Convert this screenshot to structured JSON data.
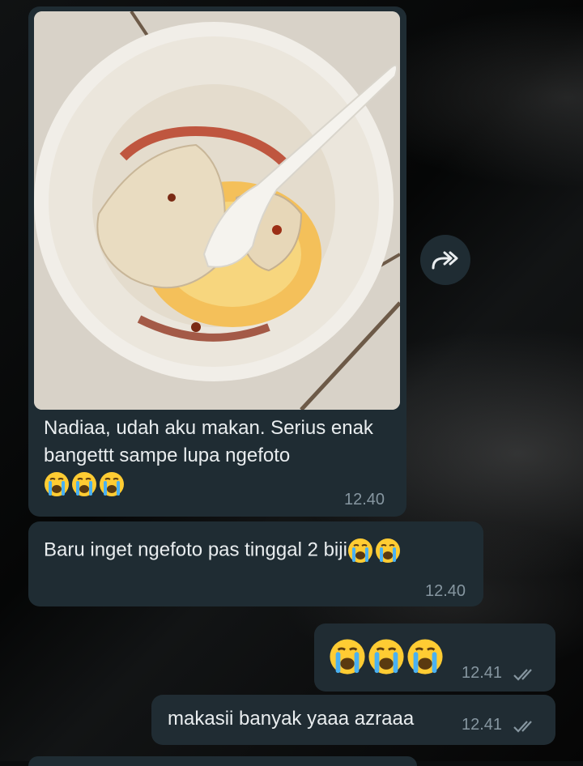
{
  "messages": [
    {
      "direction": "incoming",
      "type": "image",
      "caption": "Nadiaa, udah aku makan. Serius enak bangettt sampe lupa ngefoto",
      "emojis": [
        "loudly-crying-face",
        "loudly-crying-face",
        "loudly-crying-face"
      ],
      "time": "12.40"
    },
    {
      "direction": "incoming",
      "type": "text",
      "text": "Baru inget ngefoto pas tinggal 2 biji",
      "emojis": [
        "loudly-crying-face",
        "loudly-crying-face"
      ],
      "time": "12.40"
    },
    {
      "direction": "outgoing",
      "type": "text",
      "text": "",
      "emojis": [
        "loudly-crying-face",
        "loudly-crying-face",
        "loudly-crying-face"
      ],
      "time": "12.41",
      "status": "read-double-check"
    },
    {
      "direction": "outgoing",
      "type": "text",
      "text": "makasii banyak yaaa azraaa",
      "time": "12.41",
      "status": "read-double-check"
    }
  ],
  "icons": {
    "forward": "forward-icon",
    "ticks": "double-check-icon",
    "emoji": "loudly-crying-face-emoji"
  },
  "colors": {
    "bubble": "#1f2c33",
    "text": "#e9edef",
    "meta": "#8696a0"
  }
}
